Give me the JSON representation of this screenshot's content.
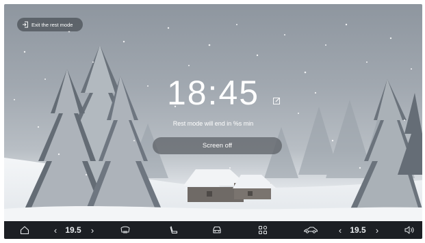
{
  "exit_rest_mode": {
    "label": "Exit the rest mode",
    "icon": "exit-icon"
  },
  "clock": {
    "time": "18:45",
    "edit_icon": "edit-icon"
  },
  "rest_message": "Rest mode will end in %s min",
  "screen_off_button": {
    "label": "Screen off"
  },
  "dock": {
    "home_icon": "home-icon",
    "left_temp": "19.5",
    "defrost_icon": "rear-defrost-icon",
    "seat_icon": "seat-icon",
    "car_front_icon": "car-front-icon",
    "apps_icon": "apps-grid-icon",
    "car_side_icon": "car-side-icon",
    "right_temp": "19.5",
    "volume_icon": "volume-icon"
  }
}
